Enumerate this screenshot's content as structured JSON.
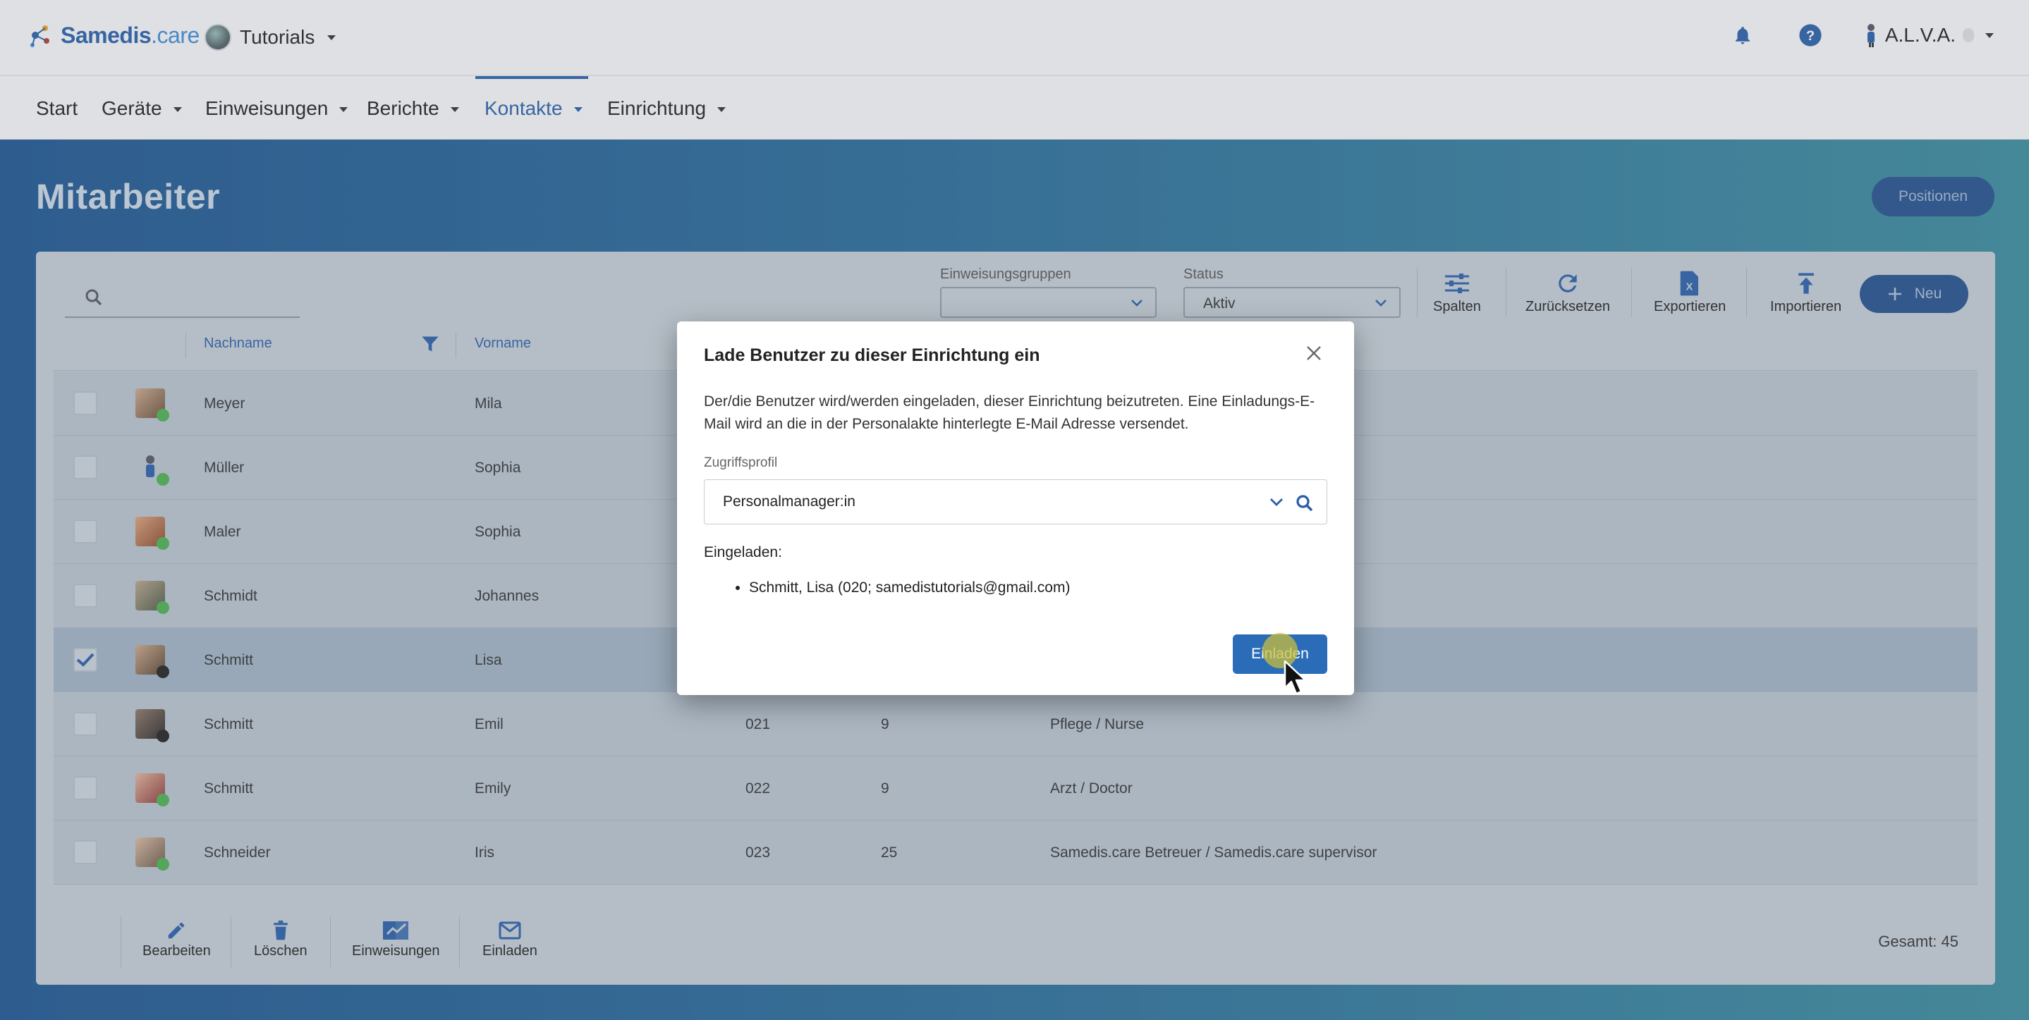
{
  "app": {
    "logo_name": "Samedis",
    "logo_tld": ".care",
    "tenant": "Tutorials",
    "user": "A.L.V.A."
  },
  "nav": {
    "items": [
      "Start",
      "Geräte",
      "Einweisungen",
      "Berichte",
      "Kontakte",
      "Einrichtung"
    ],
    "active": "Kontakte"
  },
  "page": {
    "title": "Mitarbeiter",
    "positions_button": "Positionen"
  },
  "filters": {
    "group_label": "Einweisungsgruppen",
    "group_value": "",
    "status_label": "Status",
    "status_value": "Aktiv"
  },
  "toolbar": {
    "columns": "Spalten",
    "reset": "Zurücksetzen",
    "export": "Exportieren",
    "import": "Importieren",
    "new": "Neu"
  },
  "table": {
    "headers": [
      "Nachname",
      "Vorname"
    ],
    "rows": [
      {
        "last": "Meyer",
        "first": "Mila",
        "id": "",
        "count": "",
        "position": "",
        "checked": false,
        "status": "green"
      },
      {
        "last": "Müller",
        "first": "Sophia",
        "id": "",
        "count": "",
        "position": "",
        "checked": false,
        "status": "green"
      },
      {
        "last": "Maler",
        "first": "Sophia",
        "id": "",
        "count": "",
        "position": "",
        "checked": false,
        "status": "green"
      },
      {
        "last": "Schmidt",
        "first": "Johannes",
        "id": "",
        "count": "",
        "position": "",
        "checked": false,
        "status": "green"
      },
      {
        "last": "Schmitt",
        "first": "Lisa",
        "id": "",
        "count": "",
        "position": "",
        "checked": true,
        "status": "dark"
      },
      {
        "last": "Schmitt",
        "first": "Emil",
        "id": "021",
        "count": "9",
        "position": "Pflege / Nurse",
        "checked": false,
        "status": "dark"
      },
      {
        "last": "Schmitt",
        "first": "Emily",
        "id": "022",
        "count": "9",
        "position": "Arzt / Doctor",
        "checked": false,
        "status": "green"
      },
      {
        "last": "Schneider",
        "first": "Iris",
        "id": "023",
        "count": "25",
        "position": "Samedis.care Betreuer / Samedis.care supervisor",
        "checked": false,
        "status": "green"
      }
    ]
  },
  "actions": {
    "edit": "Bearbeiten",
    "delete": "Löschen",
    "trainings": "Einweisungen",
    "invite": "Einladen"
  },
  "total": "Gesamt: 45",
  "modal": {
    "title": "Lade Benutzer zu dieser Einrichtung ein",
    "description": "Der/die Benutzer wird/werden eingeladen, dieser Einrichtung beizutreten. Eine Einladungs-E-Mail wird an die in der Personalakte hinterlegte E-Mail Adresse versendet.",
    "profile_label": "Zugriffsprofil",
    "profile_value": "Personalmanager:in",
    "invited_label": "Eingeladen:",
    "invited": [
      "Schmitt, Lisa (020; samedistutorials@gmail.com)"
    ],
    "submit": "Einladen"
  },
  "colors": {
    "brand": "#2a5ea8",
    "status_green": "#4caf50",
    "status_dark": "#222222"
  },
  "icons": [
    "bell-icon",
    "help-icon",
    "search-icon",
    "filter-icon",
    "columns-icon",
    "reset-icon",
    "export-icon",
    "import-icon",
    "plus-icon",
    "edit-icon",
    "delete-icon",
    "trainings-icon",
    "mail-icon",
    "close-icon",
    "chevron-down-icon"
  ]
}
